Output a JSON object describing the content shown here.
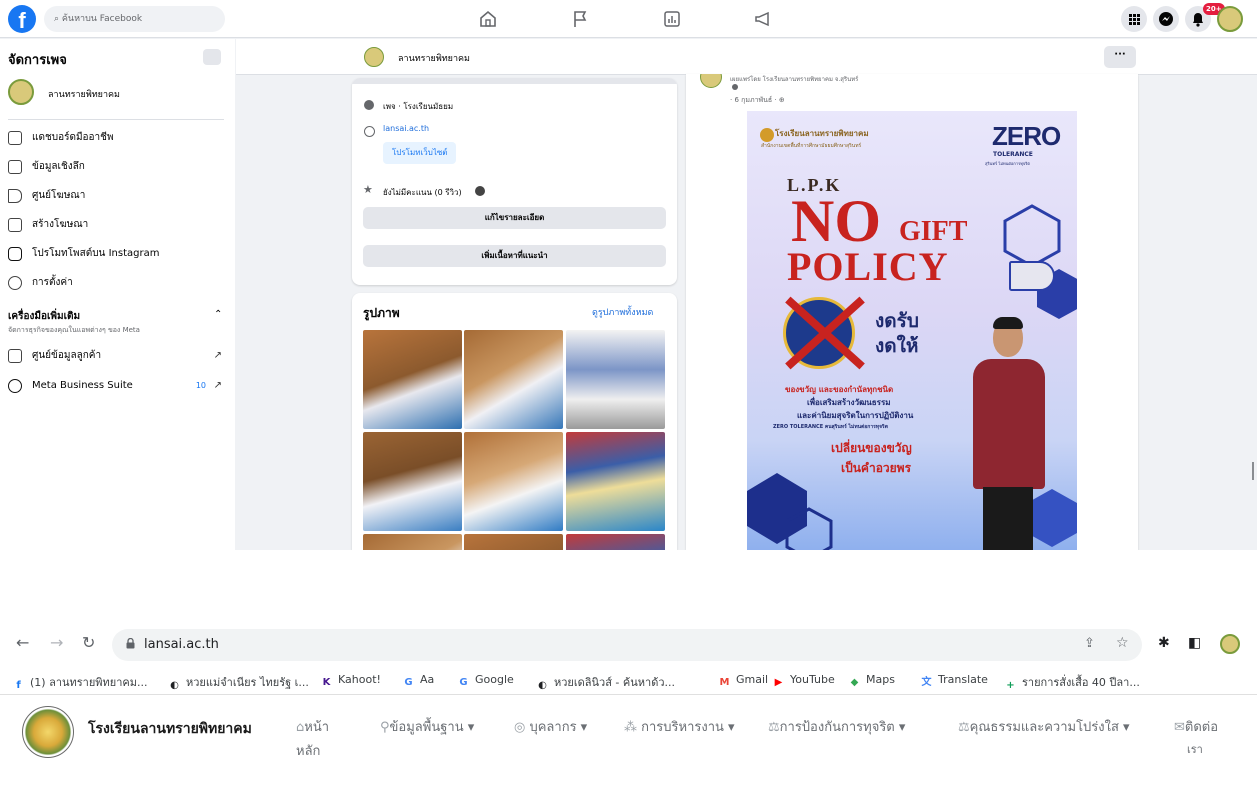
{
  "facebook": {
    "search_placeholder": "ค้นหาบน Facebook",
    "notification_count": "20+",
    "manage_title": "จัดการเพจ",
    "page_name": "ลานทรายพิทยาคม",
    "menu_items": [
      {
        "label": "แดชบอร์ดมืออาชีพ"
      },
      {
        "label": "ข้อมูลเชิงลึก"
      },
      {
        "label": "ศูนย์โฆษณา"
      },
      {
        "label": "สร้างโฆษณา"
      },
      {
        "label": "โปรโมทโพสต์บน Instagram"
      },
      {
        "label": "การตั้งค่า"
      }
    ],
    "tools_title": "เครื่องมือเพิ่มเติม",
    "tools_subtitle": "จัดการธุรกิจของคุณในแอพต่างๆ ของ Meta",
    "tools_items": [
      {
        "label": "ศูนย์ข้อมูลลูกค้า",
        "count": ""
      },
      {
        "label": "Meta Business Suite",
        "count": "10"
      }
    ],
    "about": {
      "category": "เพจ · โรงเรียนมัธยม",
      "website": "lansai.ac.th",
      "promote_website": "โปรโมทเว็บไซต์",
      "rating": "ยังไม่มีคะแนน (0 รีวิว)",
      "edit_details": "แก้ไขรายละเอียด",
      "add_featured": "เพิ่มเนื้อหาที่แนะนำ"
    },
    "photos": {
      "title": "รูปภาพ",
      "see_all": "ดูรูปภาพทั้งหมด"
    },
    "post": {
      "author_line": "เผยแพร่โดย โรงเรียนลานทรายพิทยาคม จ.สุรินทร์",
      "date": "6 กุมภาพันธ์ ·"
    },
    "poster": {
      "school": "โรงเรียนลานทรายพิทยาคม",
      "office": "สำนักงานเขตพื้นที่การศึกษามัธยมศึกษาสุรินทร์",
      "zero": "ZERO",
      "tolerance": "TOLERANCE",
      "tolerance_sub": "สุรินทร์ ไม่ทนต่อการทุจริต",
      "lpk": "L.P.K",
      "no": "NO",
      "gift": "GIFT",
      "policy": "POLICY",
      "no_receive": "งดรับ",
      "no_give": "งดให้",
      "line1": "ของขวัญ และของกำนัลทุกชนิด",
      "line2": "เพื่อเสริมสร้างวัฒนธรรม",
      "line3": "และค่านิยมสุจริตในการปฏิบัติงาน",
      "line4": "ZERO TOLERANCE คนสุรินทร์ ไม่ทนต่อการทุจริต",
      "line5": "เปลี่ยนของขวัญ",
      "line6": "เป็นคำอวยพร"
    }
  },
  "browser": {
    "url": "lansai.ac.th",
    "bookmarks": [
      {
        "label": "(1) ลานทรายพิทยาคม...",
        "color": "#1877f2",
        "glyph": "f"
      },
      {
        "label": "หวยแม่จำเนียร ไทยรัฐ เ...",
        "color": "#202124",
        "glyph": "◐"
      },
      {
        "label": "Kahoot!",
        "color": "#46178f",
        "glyph": "K"
      },
      {
        "label": "Aa",
        "color": "#4285f4",
        "glyph": "G"
      },
      {
        "label": "Google",
        "color": "#4285f4",
        "glyph": "G"
      },
      {
        "label": "หวยเดลินิวส์ - ค้นหาด้ว...",
        "color": "#202124",
        "glyph": "◐"
      },
      {
        "label": "Gmail",
        "color": "#ea4335",
        "glyph": "M"
      },
      {
        "label": "YouTube",
        "color": "#ff0000",
        "glyph": "▶"
      },
      {
        "label": "Maps",
        "color": "#34a853",
        "glyph": "◆"
      },
      {
        "label": "Translate",
        "color": "#4285f4",
        "glyph": "文"
      },
      {
        "label": "รายการสั่งเสื้อ 40 ปีลา...",
        "color": "#0f9d58",
        "glyph": "+"
      }
    ]
  },
  "site": {
    "name": "โรงเรียนลานทรายพิทยาคม",
    "menu": [
      {
        "label": "หน้า",
        "label2": "หลัก"
      },
      {
        "label": "ข้อมูลพื้นฐาน ▾"
      },
      {
        "label": "บุคลากร ▾"
      },
      {
        "label": "การบริหารงาน ▾"
      },
      {
        "label": "การป้องกันการทุจริต ▾"
      },
      {
        "label": "คุณธรรมและความโปร่งใส ▾"
      },
      {
        "label": "ติดต่อ",
        "label2": "เรา"
      }
    ]
  }
}
